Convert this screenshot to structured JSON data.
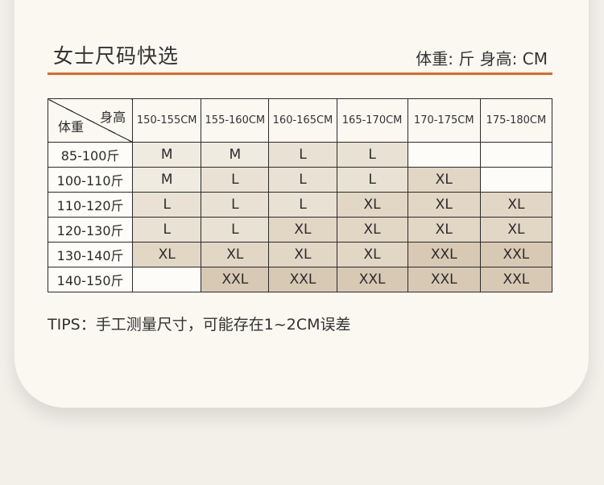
{
  "header": {
    "title": "女士尺码快选",
    "units": "体重: 斤  身高: CM"
  },
  "colors": {
    "accent_rule": "#de6a21",
    "card_bg": "#fbf8f1",
    "page_bg": "#f3f0ea"
  },
  "table": {
    "corner_top": "身高",
    "corner_bottom": "体重",
    "height_ranges": [
      "150-155CM",
      "155-160CM",
      "160-165CM",
      "165-170CM",
      "170-175CM",
      "175-180CM"
    ],
    "rows": [
      {
        "weight": "85-100斤",
        "sizes": [
          "M",
          "M",
          "L",
          "L",
          "",
          ""
        ]
      },
      {
        "weight": "100-110斤",
        "sizes": [
          "M",
          "L",
          "L",
          "L",
          "XL",
          ""
        ]
      },
      {
        "weight": "110-120斤",
        "sizes": [
          "L",
          "L",
          "L",
          "XL",
          "XL",
          "XL"
        ]
      },
      {
        "weight": "120-130斤",
        "sizes": [
          "L",
          "L",
          "XL",
          "XL",
          "XL",
          "XL"
        ]
      },
      {
        "weight": "130-140斤",
        "sizes": [
          "XL",
          "XL",
          "XL",
          "XL",
          "XXL",
          "XXL"
        ]
      },
      {
        "weight": "140-150斤",
        "sizes": [
          "",
          "XXL",
          "XXL",
          "XXL",
          "XXL",
          "XXL"
        ]
      }
    ]
  },
  "tips": "TIPS：手工测量尺寸，可能存在1~2CM误差"
}
